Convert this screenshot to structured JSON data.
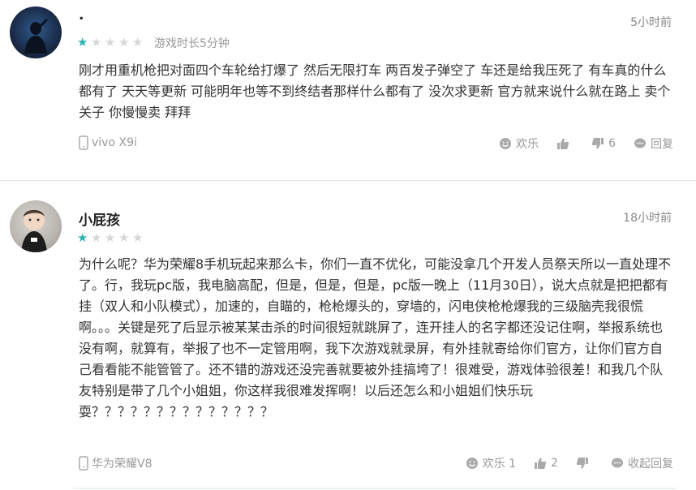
{
  "reviews": [
    {
      "name": ".",
      "time": "5小时前",
      "stars": 1,
      "max_stars": 5,
      "playtime": "游戏时长5分钟",
      "content": "刚才用重机枪把对面四个车轮给打爆了 然后无限打车 两百发子弹空了 车还是给我压死了 有车真的什么都有了 天天等更新 可能明年也等不到终结者那样什么都有了 没次求更新 官方就来说什么就在路上 卖个关子 你慢慢卖 拜拜",
      "device": "vivo X9i",
      "fun_label": "欢乐",
      "like_count": "",
      "dislike_count": "6",
      "reply_label": "回复"
    },
    {
      "name": "小屁孩",
      "time": "18小时前",
      "stars": 1,
      "max_stars": 5,
      "playtime": "",
      "content": "为什么呢？华为荣耀8手机玩起来那么卡，你们一直不优化，可能没拿几个开发人员祭天所以一直处理不了。行，我玩pc版，我电脑高配，但是，但是，但是，pc版一晚上（11月30日），说大点就是把把都有挂（双人和小队模式），加速的，自瞄的，枪枪爆头的，穿墙的，闪电侠枪枪爆我的三级脑壳我很慌啊。。。关键是死了后显示被某某击杀的时间很短就跳屏了，连开挂人的名字都还没记住啊，举报系统也没有啊，就算有，举报了也不一定管用啊，我下次游戏就录屏，有外挂就寄给你们官方，让你们官方自己看看能不能管管了。还不错的游戏还没完善就要被外挂搞垮了！很难受，游戏体验很差！和我几个队友特别是带了几个小姐姐，你这样我很难发挥啊！以后还怎么和小姐姐们快乐玩耍？？？？？？？？？？？？？？",
      "device": "华为荣耀V8",
      "fun_label": "欢乐 1",
      "like_count": "2",
      "dislike_count": "",
      "reply_label": "收起回复"
    }
  ],
  "colors": {
    "star_on": "#2cb3b0",
    "star_off": "#d6d6d6",
    "meta_text": "#999999"
  },
  "icons": [
    "avatar",
    "star-icon",
    "phone-icon",
    "smile-icon",
    "thumbs-up-icon",
    "thumbs-down-icon",
    "comment-icon"
  ]
}
